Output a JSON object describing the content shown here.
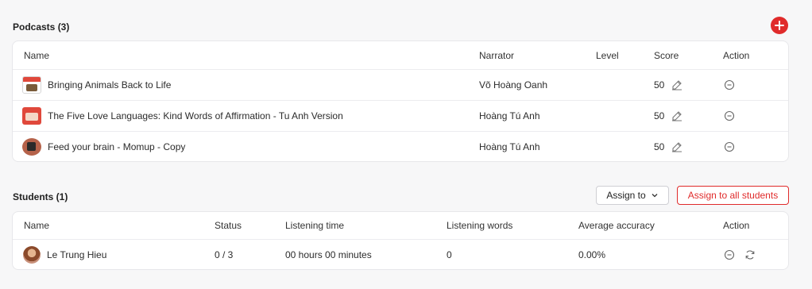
{
  "podcasts": {
    "title": "Podcasts (3)",
    "columns": {
      "name": "Name",
      "narrator": "Narrator",
      "level": "Level",
      "score": "Score",
      "action": "Action"
    },
    "rows": [
      {
        "name": "Bringing Animals Back to Life",
        "narrator": "Võ Hoàng Oanh",
        "level": "",
        "score": "50"
      },
      {
        "name": "The Five Love Languages: Kind Words of Affirmation - Tu Anh Version",
        "narrator": "Hoàng Tú Anh",
        "level": "",
        "score": "50"
      },
      {
        "name": "Feed your brain - Momup - Copy",
        "narrator": "Hoàng Tú Anh",
        "level": "",
        "score": "50"
      }
    ]
  },
  "students": {
    "title": "Students (1)",
    "assign_to_label": "Assign to",
    "assign_all_label": "Assign to all students",
    "columns": {
      "name": "Name",
      "status": "Status",
      "listening_time": "Listening time",
      "listening_words": "Listening words",
      "average_accuracy": "Average accuracy",
      "action": "Action"
    },
    "rows": [
      {
        "name": "Le Trung Hieu",
        "status": "0 / 3",
        "listening_time": "00 hours 00 minutes",
        "listening_words": "0",
        "average_accuracy": "0.00%"
      }
    ]
  },
  "colors": {
    "accent": "#e02b2b",
    "border": "#e7e7ea",
    "background": "#f7f7f8"
  },
  "icons": {
    "add": "plus-icon",
    "edit": "edit-icon",
    "remove": "minus-circle-icon",
    "reset": "refresh-icon",
    "dropdown": "chevron-down-icon"
  }
}
